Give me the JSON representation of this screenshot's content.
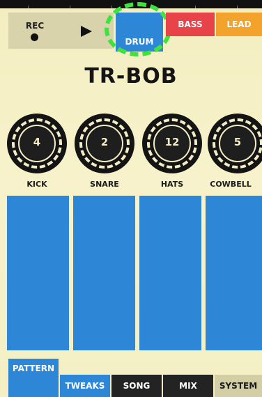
{
  "transport": {
    "rec_label": "REC",
    "play_icon": "play-icon"
  },
  "instruments": {
    "drum": "DRUM",
    "bass": "BASS",
    "lead": "LEAD",
    "highlight_color": "#3ee33e",
    "drum_color": "#2e86d6",
    "bass_color": "#e9434a",
    "lead_color": "#f3a22c"
  },
  "title": "TR-BOB",
  "knobs": [
    {
      "label": "KICK",
      "value": "4"
    },
    {
      "label": "SNARE",
      "value": "2"
    },
    {
      "label": "HATS",
      "value": "12"
    },
    {
      "label": "COWBELL",
      "value": "5"
    }
  ],
  "pads": {
    "color": "#2e86d6",
    "count": 4
  },
  "tabs": {
    "pattern": "PATTERN",
    "tweaks": "TWEAKS",
    "song": "SONG",
    "mix": "MIX",
    "system": "SYSTEM"
  }
}
